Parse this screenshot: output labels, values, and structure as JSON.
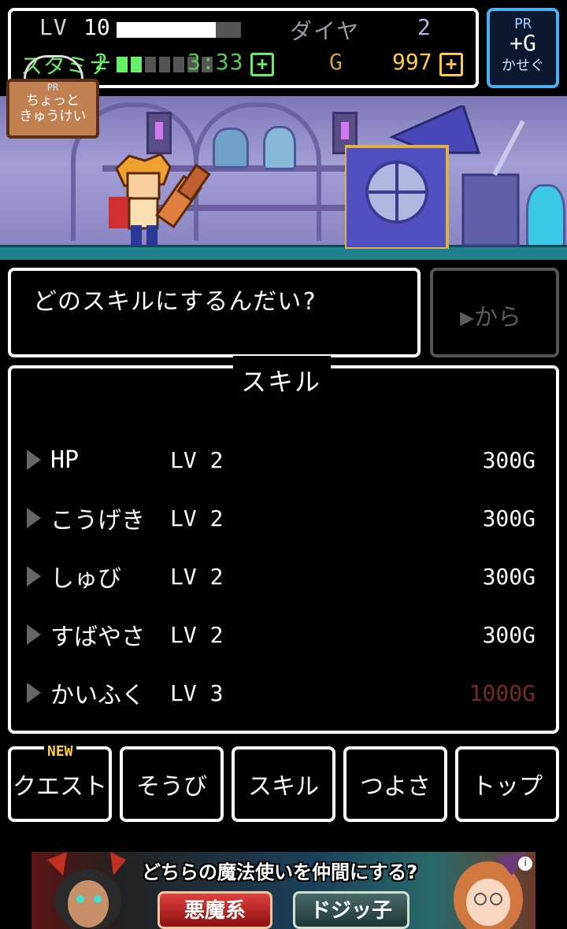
{
  "status": {
    "lv_label": "LV",
    "lv_value": "10",
    "xp_fraction": 0.8,
    "diamond_label": "ダイヤ",
    "diamond_value": "2",
    "stamina_label": "スタミナ",
    "stamina_value": "2",
    "stamina_blocks_filled": 2,
    "stamina_blocks_total": 7,
    "timer": "3:33",
    "gold_label": "G",
    "gold_value": "997",
    "plus_symbol": "+"
  },
  "pr_button": {
    "pr": "PR",
    "main": "+G",
    "sub": "かせぐ"
  },
  "scene": {
    "sign_pr": "PR",
    "sign_line1": "ちょっと",
    "sign_line2": "きゅうけい"
  },
  "message": "どのスキルにするんだい?",
  "kara_button": "▶から",
  "skills_title": "スキル",
  "skills": [
    {
      "name": "HP",
      "lv": "LV 2",
      "cost": "300G",
      "affordable": true
    },
    {
      "name": "こうげき",
      "lv": "LV 2",
      "cost": "300G",
      "affordable": true
    },
    {
      "name": "しゅび",
      "lv": "LV 2",
      "cost": "300G",
      "affordable": true
    },
    {
      "name": "すばやさ",
      "lv": "LV 2",
      "cost": "300G",
      "affordable": true
    },
    {
      "name": "かいふく",
      "lv": "LV 3",
      "cost": "1000G",
      "affordable": false
    }
  ],
  "nav": {
    "new_badge": "NEW",
    "items": [
      "クエスト",
      "そうび",
      "スキル",
      "つよさ",
      "トップ"
    ]
  },
  "ad": {
    "title": "どちらの魔法使いを仲間にする?",
    "button1": "悪魔系",
    "button2": "ドジッ子",
    "info": "i"
  },
  "colors": {
    "stamina_green": "#66ee66",
    "gold_yellow": "#ffcc44",
    "unaffordable_cost": "#7a2a2a",
    "pr_border": "#4bb0f0"
  }
}
